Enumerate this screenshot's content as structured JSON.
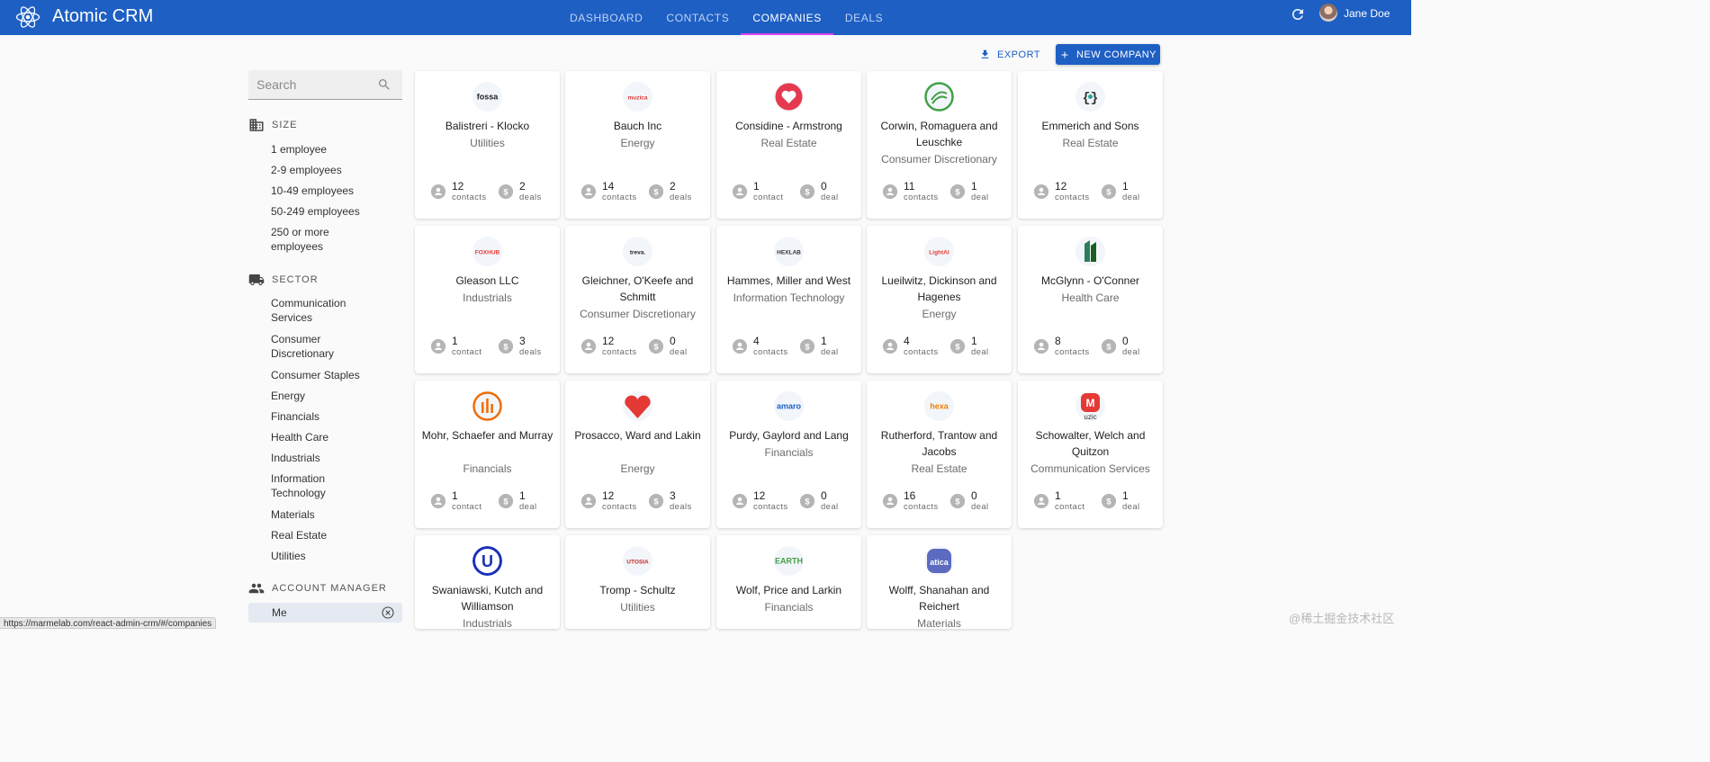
{
  "app": {
    "title": "Atomic CRM"
  },
  "nav": {
    "tabs": [
      "DASHBOARD",
      "CONTACTS",
      "COMPANIES",
      "DEALS"
    ],
    "active": "COMPANIES"
  },
  "user": {
    "name": "Jane Doe"
  },
  "toolbar": {
    "export_label": "EXPORT",
    "new_label": "NEW COMPANY"
  },
  "sidebar": {
    "search_placeholder": "Search",
    "size": {
      "title": "SIZE",
      "items": [
        "1 employee",
        "2-9 employees",
        "10-49 employees",
        "50-249 employees",
        "250 or more employees"
      ]
    },
    "sector": {
      "title": "SECTOR",
      "items": [
        "Communication Services",
        "Consumer Discretionary",
        "Consumer Staples",
        "Energy",
        "Financials",
        "Health Care",
        "Industrials",
        "Information Technology",
        "Materials",
        "Real Estate",
        "Utilities"
      ]
    },
    "account_manager": {
      "title": "ACCOUNT MANAGER",
      "selected": "Me"
    }
  },
  "companies": [
    {
      "name": "Balistreri - Klocko",
      "sector": "Utilities",
      "contacts": "12",
      "contacts_label": "contacts",
      "deals": "2",
      "deals_label": "deals",
      "logo_text": "fossa",
      "logo_color": "#222222"
    },
    {
      "name": "Bauch Inc",
      "sector": "Energy",
      "contacts": "14",
      "contacts_label": "contacts",
      "deals": "2",
      "deals_label": "deals",
      "logo_text": "muzica",
      "logo_color": "#e53935"
    },
    {
      "name": "Considine - Armstrong",
      "sector": "Real Estate",
      "contacts": "1",
      "contacts_label": "contact",
      "deals": "0",
      "deals_label": "deal",
      "logo_text": "",
      "logo_color": "#e53950"
    },
    {
      "name": "Corwin, Romaguera and Leuschke",
      "sector": "Consumer Discretionary",
      "contacts": "11",
      "contacts_label": "contacts",
      "deals": "1",
      "deals_label": "deal",
      "logo_text": "",
      "logo_color": "#43a047"
    },
    {
      "name": "Emmerich and Sons",
      "sector": "Real Estate",
      "contacts": "12",
      "contacts_label": "contacts",
      "deals": "1",
      "deals_label": "deal",
      "logo_text": "",
      "logo_color": "#26a69a"
    },
    {
      "name": "Gleason LLC",
      "sector": "Industrials",
      "contacts": "1",
      "contacts_label": "contact",
      "deals": "3",
      "deals_label": "deals",
      "logo_text": "FOXHUB",
      "logo_color": "#e53935"
    },
    {
      "name": "Gleichner, O'Keefe and Schmitt",
      "sector": "Consumer Discretionary",
      "contacts": "12",
      "contacts_label": "contacts",
      "deals": "0",
      "deals_label": "deal",
      "logo_text": "treva.",
      "logo_color": "#222222"
    },
    {
      "name": "Hammes, Miller and West",
      "sector": "Information Technology",
      "contacts": "4",
      "contacts_label": "contacts",
      "deals": "1",
      "deals_label": "deal",
      "logo_text": "HEXLAB",
      "logo_color": "#333333"
    },
    {
      "name": "Lueilwitz, Dickinson and Hagenes",
      "sector": "Energy",
      "contacts": "4",
      "contacts_label": "contacts",
      "deals": "1",
      "deals_label": "deal",
      "logo_text": "LightAI",
      "logo_color": "#e53935"
    },
    {
      "name": "McGlynn - O'Conner",
      "sector": "Health Care",
      "contacts": "8",
      "contacts_label": "contacts",
      "deals": "0",
      "deals_label": "deal",
      "logo_text": "",
      "logo_color": "#2e7d5b"
    },
    {
      "name": "Mohr, Schaefer and Murray",
      "sector": "Financials",
      "contacts": "1",
      "contacts_label": "contact",
      "deals": "1",
      "deals_label": "deal",
      "logo_text": "",
      "logo_color": "#ef6c00"
    },
    {
      "name": "Prosacco, Ward and Lakin",
      "sector": "Energy",
      "contacts": "12",
      "contacts_label": "contacts",
      "deals": "3",
      "deals_label": "deals",
      "logo_text": "",
      "logo_color": "#e53935"
    },
    {
      "name": "Purdy, Gaylord and Lang",
      "sector": "Financials",
      "contacts": "12",
      "contacts_label": "contacts",
      "deals": "0",
      "deals_label": "deal",
      "logo_text": "amaro",
      "logo_color": "#1e5fc4"
    },
    {
      "name": "Rutherford, Trantow and Jacobs",
      "sector": "Real Estate",
      "contacts": "16",
      "contacts_label": "contacts",
      "deals": "0",
      "deals_label": "deal",
      "logo_text": "hexa",
      "logo_color": "#f57c00"
    },
    {
      "name": "Schowalter, Welch and Quitzon",
      "sector": "Communication Services",
      "contacts": "1",
      "contacts_label": "contact",
      "deals": "1",
      "deals_label": "deal",
      "logo_text": "uzic",
      "logo_color": "#e53935"
    },
    {
      "name": "Swaniawski, Kutch and Williamson",
      "sector": "Industrials",
      "contacts": "",
      "contacts_label": "",
      "deals": "",
      "deals_label": "",
      "logo_text": "U",
      "logo_color": "#1a2fb8"
    },
    {
      "name": "Tromp - Schultz",
      "sector": "Utilities",
      "contacts": "",
      "contacts_label": "",
      "deals": "",
      "deals_label": "",
      "logo_text": "UTOSIA",
      "logo_color": "#c62828"
    },
    {
      "name": "Wolf, Price and Larkin",
      "sector": "Financials",
      "contacts": "",
      "contacts_label": "",
      "deals": "",
      "deals_label": "",
      "logo_text": "EARTH",
      "logo_color": "#43a047"
    },
    {
      "name": "Wolff, Shanahan and Reichert",
      "sector": "Materials",
      "contacts": "",
      "contacts_label": "",
      "deals": "",
      "deals_label": "",
      "logo_text": "atica",
      "logo_color": "#5c6bc0"
    }
  ],
  "status_url": "https://marmelab.com/react-admin-crm/#/companies",
  "watermark": "@稀土掘金技术社区"
}
